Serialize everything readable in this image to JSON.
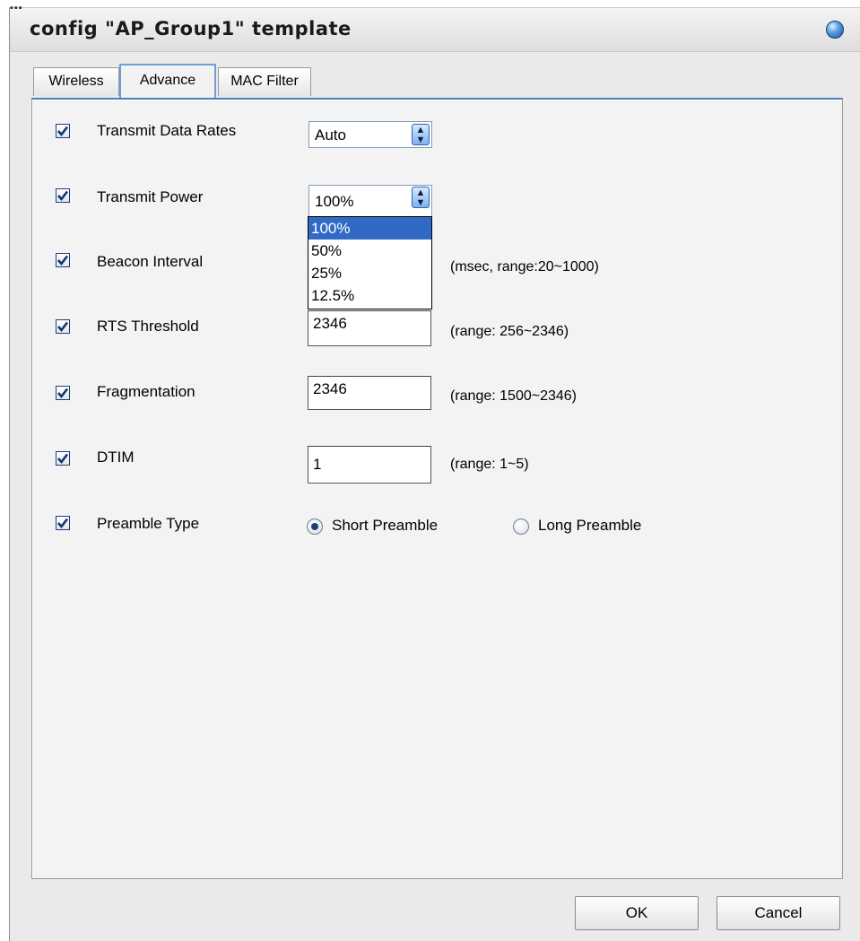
{
  "window": {
    "title": "config \"AP_Group1\" template"
  },
  "tabs": [
    {
      "label": "Wireless",
      "active": false
    },
    {
      "label": "Advance",
      "active": true
    },
    {
      "label": "MAC Filter",
      "active": false
    }
  ],
  "settings": {
    "transmit_data_rates": {
      "checked": true,
      "label": "Transmit Data Rates",
      "value": "Auto"
    },
    "transmit_power": {
      "checked": true,
      "label": "Transmit Power",
      "value": "100%",
      "options": [
        "100%",
        "50%",
        "25%",
        "12.5%"
      ],
      "selected_option": "100%"
    },
    "beacon_interval": {
      "checked": true,
      "label": "Beacon Interval",
      "hint": "(msec, range:20~1000)"
    },
    "rts_threshold": {
      "checked": true,
      "label": "RTS Threshold",
      "value": "2346",
      "hint": "(range: 256~2346)"
    },
    "fragmentation": {
      "checked": true,
      "label": "Fragmentation",
      "value": "2346",
      "hint": "(range: 1500~2346)"
    },
    "dtim": {
      "checked": true,
      "label": "DTIM",
      "value": "1",
      "hint": "(range: 1~5)"
    },
    "preamble_type": {
      "checked": true,
      "label": "Preamble Type",
      "options": [
        "Short Preamble",
        "Long Preamble"
      ],
      "selected": "Short Preamble"
    }
  },
  "buttons": {
    "ok": "OK",
    "cancel": "Cancel"
  },
  "colors": {
    "tab_accent": "#4a7fc0",
    "selection": "#316ac5",
    "checkbox": "#1d3f74"
  }
}
